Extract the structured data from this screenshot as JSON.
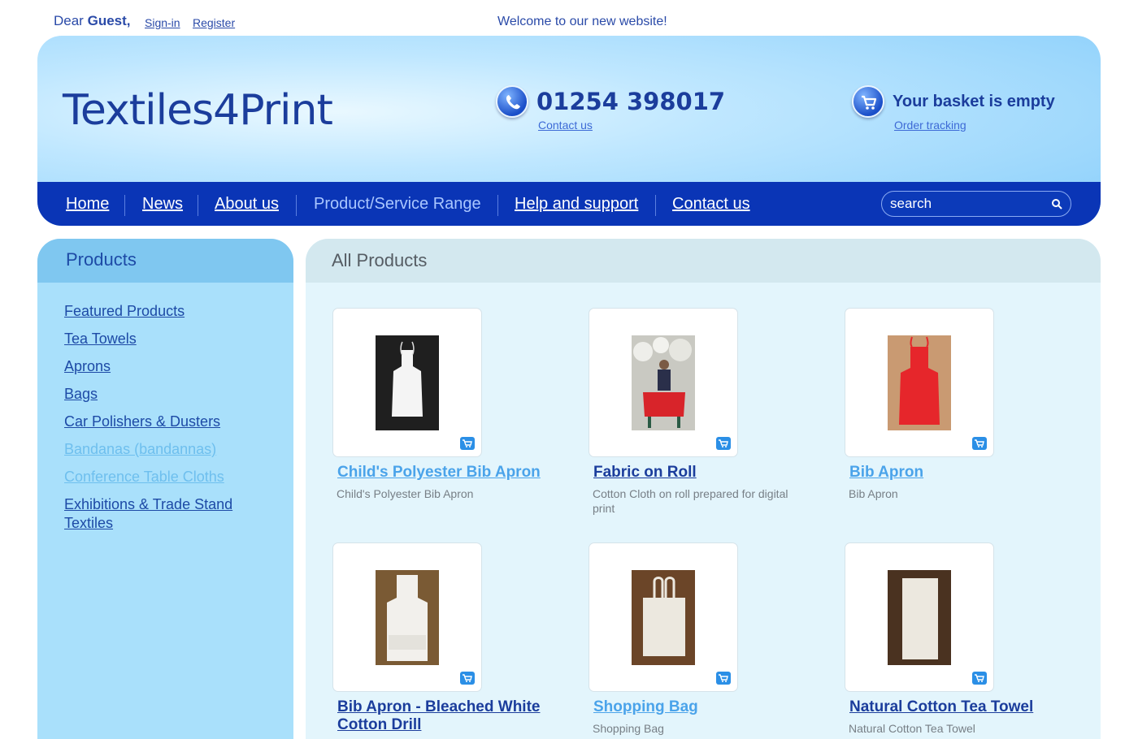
{
  "topbar": {
    "greeting_prefix": "Dear",
    "greeting_name": "Guest,",
    "signin": "Sign-in",
    "register": "Register",
    "welcome": "Welcome to our new website!"
  },
  "header": {
    "logo": "Textiles4Print",
    "phone": "01254 398017",
    "contact_link": "Contact us",
    "basket": "Your basket is empty",
    "order_tracking": "Order tracking"
  },
  "nav": {
    "items": [
      {
        "label": "Home"
      },
      {
        "label": "News"
      },
      {
        "label": "About us"
      },
      {
        "label": "Product/Service Range"
      },
      {
        "label": "Help and support"
      },
      {
        "label": "Contact us"
      }
    ],
    "search_placeholder": "search"
  },
  "sidebar": {
    "title": "Products",
    "items": [
      {
        "label": "Featured Products"
      },
      {
        "label": "Tea Towels"
      },
      {
        "label": "Aprons"
      },
      {
        "label": "Bags"
      },
      {
        "label": "Car Polishers & Dusters"
      },
      {
        "label": "Bandanas (bandannas)"
      },
      {
        "label": "Conference Table Cloths"
      },
      {
        "label": "Exhibitions & Trade Stand Textiles"
      }
    ]
  },
  "main": {
    "title": "All Products",
    "products": [
      {
        "name": "Child's Polyester Bib Apron",
        "desc": "Child's Polyester Bib Apron"
      },
      {
        "name": "Fabric on Roll",
        "desc": "Cotton Cloth on roll prepared for digital print"
      },
      {
        "name": "Bib Apron",
        "desc": "Bib Apron"
      },
      {
        "name": "Bib Apron - Bleached White Cotton Drill",
        "desc": ""
      },
      {
        "name": "Shopping Bag",
        "desc": "Shopping Bag"
      },
      {
        "name": "Natural Cotton Tea Towel",
        "desc": "Natural Cotton Tea Towel"
      }
    ]
  },
  "colors": {
    "nav_bg": "#0a35b6",
    "brand_text": "#1b3d9c",
    "sidebar_bg": "#a9e0fb",
    "main_bg": "#e3f5fc"
  },
  "icons": {
    "phone": "phone-icon",
    "basket": "basket-icon",
    "search": "search-icon",
    "add_to_cart": "add-to-cart-icon"
  }
}
